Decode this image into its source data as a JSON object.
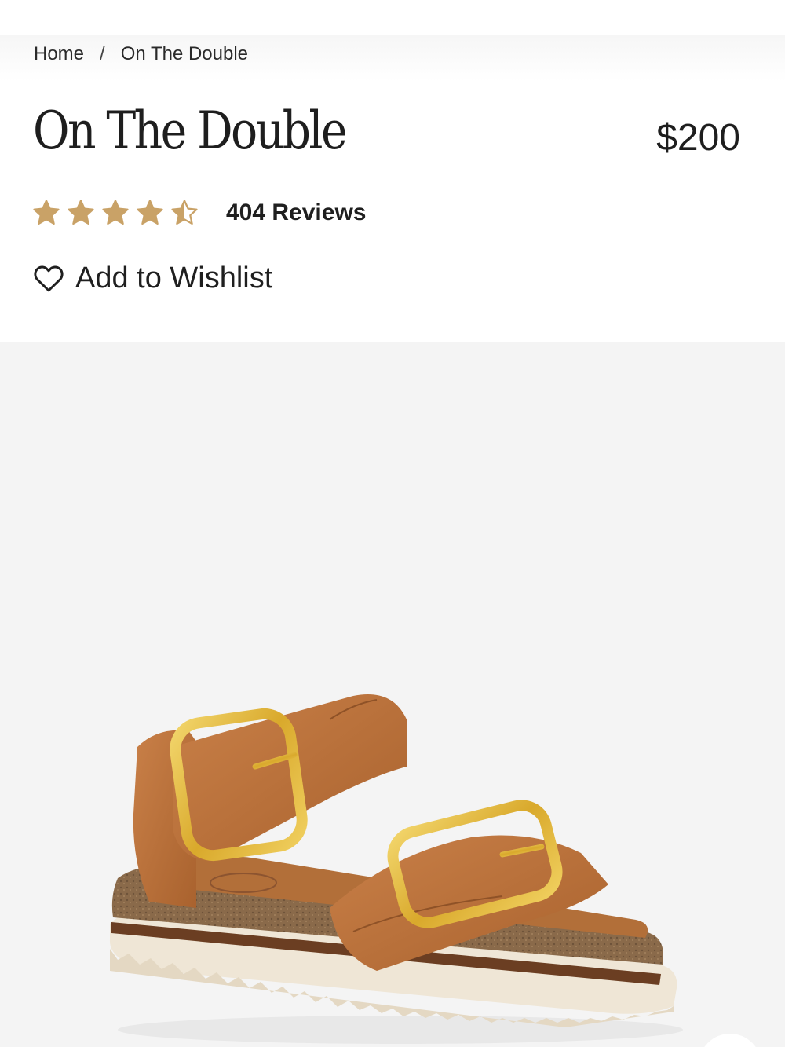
{
  "breadcrumb": {
    "home": "Home",
    "separator": "/",
    "current": "On The Double"
  },
  "product": {
    "title": "On The Double",
    "price": "$200",
    "rating": 4.5,
    "rating_max": 5,
    "reviews_label": "404 Reviews",
    "wishlist_label": "Add to Wishlist"
  },
  "colors": {
    "star_gold": "#C9A267",
    "gallery_bg": "#F4F4F4",
    "leather": "#B8733E",
    "buckle": "#E0B63C"
  },
  "icons": {
    "wishlist": "heart-outline-icon",
    "rating": "star-icon"
  }
}
